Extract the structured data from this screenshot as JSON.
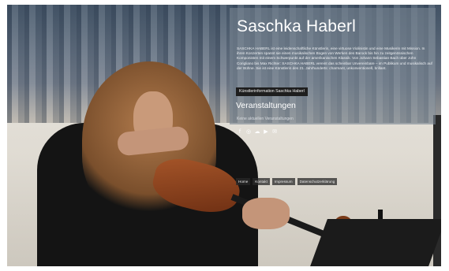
{
  "profile": {
    "name": "Saschka Haberl",
    "bio": "SASCHKA HABERL ist eine leidenschaftliche Künstlerin, eine virtuose Violinistin und eine Musikerin mit Mission. In ihren Konzerten spannt sie einen musikalischen Bogen von Werken des Barock bis hin zu zeitgenössischen Komponisten mit einem Schwerpunkt auf der amerikanischen Klassik. Von Johann Sebastian Bach über John Corigliano bis Max Richter: SASCHKA HABERL vereint das scheinbar Unvereinbare – im Publikum und musikalisch auf der Bühne. Sie ist eine Künstlerin des 21. Jahrhunderts: charmant, unkonventionell, brillant.",
    "info_button": "Künstlerinformation Saschka Haberl"
  },
  "events": {
    "heading": "Veranstaltungen",
    "empty_text": "Keine aktuellen Veranstaltungen"
  },
  "social": [
    {
      "icon": "facebook-icon",
      "glyph": "f"
    },
    {
      "icon": "instagram-icon",
      "glyph": "◎"
    },
    {
      "icon": "soundcloud-icon",
      "glyph": "☁"
    },
    {
      "icon": "youtube-icon",
      "glyph": "▶"
    },
    {
      "icon": "email-icon",
      "glyph": "✉"
    }
  ],
  "footer": {
    "links": [
      "Home",
      "Kontakt",
      "Impressum",
      "Datenschutzerklärung"
    ]
  },
  "colors": {
    "overlay": "#788491",
    "button_bg": "#1e1e1e",
    "text": "#ffffff"
  }
}
